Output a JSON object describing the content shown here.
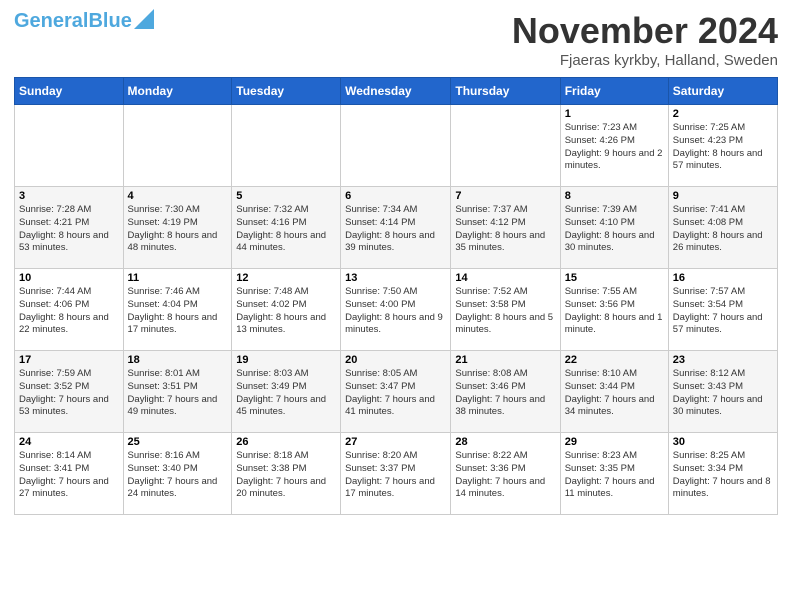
{
  "header": {
    "logo_line1": "General",
    "logo_line2": "Blue",
    "month_title": "November 2024",
    "location": "Fjaeras kyrkby, Halland, Sweden"
  },
  "days_of_week": [
    "Sunday",
    "Monday",
    "Tuesday",
    "Wednesday",
    "Thursday",
    "Friday",
    "Saturday"
  ],
  "weeks": [
    [
      {
        "day": "",
        "info": ""
      },
      {
        "day": "",
        "info": ""
      },
      {
        "day": "",
        "info": ""
      },
      {
        "day": "",
        "info": ""
      },
      {
        "day": "",
        "info": ""
      },
      {
        "day": "1",
        "info": "Sunrise: 7:23 AM\nSunset: 4:26 PM\nDaylight: 9 hours and 2 minutes."
      },
      {
        "day": "2",
        "info": "Sunrise: 7:25 AM\nSunset: 4:23 PM\nDaylight: 8 hours and 57 minutes."
      }
    ],
    [
      {
        "day": "3",
        "info": "Sunrise: 7:28 AM\nSunset: 4:21 PM\nDaylight: 8 hours and 53 minutes."
      },
      {
        "day": "4",
        "info": "Sunrise: 7:30 AM\nSunset: 4:19 PM\nDaylight: 8 hours and 48 minutes."
      },
      {
        "day": "5",
        "info": "Sunrise: 7:32 AM\nSunset: 4:16 PM\nDaylight: 8 hours and 44 minutes."
      },
      {
        "day": "6",
        "info": "Sunrise: 7:34 AM\nSunset: 4:14 PM\nDaylight: 8 hours and 39 minutes."
      },
      {
        "day": "7",
        "info": "Sunrise: 7:37 AM\nSunset: 4:12 PM\nDaylight: 8 hours and 35 minutes."
      },
      {
        "day": "8",
        "info": "Sunrise: 7:39 AM\nSunset: 4:10 PM\nDaylight: 8 hours and 30 minutes."
      },
      {
        "day": "9",
        "info": "Sunrise: 7:41 AM\nSunset: 4:08 PM\nDaylight: 8 hours and 26 minutes."
      }
    ],
    [
      {
        "day": "10",
        "info": "Sunrise: 7:44 AM\nSunset: 4:06 PM\nDaylight: 8 hours and 22 minutes."
      },
      {
        "day": "11",
        "info": "Sunrise: 7:46 AM\nSunset: 4:04 PM\nDaylight: 8 hours and 17 minutes."
      },
      {
        "day": "12",
        "info": "Sunrise: 7:48 AM\nSunset: 4:02 PM\nDaylight: 8 hours and 13 minutes."
      },
      {
        "day": "13",
        "info": "Sunrise: 7:50 AM\nSunset: 4:00 PM\nDaylight: 8 hours and 9 minutes."
      },
      {
        "day": "14",
        "info": "Sunrise: 7:52 AM\nSunset: 3:58 PM\nDaylight: 8 hours and 5 minutes."
      },
      {
        "day": "15",
        "info": "Sunrise: 7:55 AM\nSunset: 3:56 PM\nDaylight: 8 hours and 1 minute."
      },
      {
        "day": "16",
        "info": "Sunrise: 7:57 AM\nSunset: 3:54 PM\nDaylight: 7 hours and 57 minutes."
      }
    ],
    [
      {
        "day": "17",
        "info": "Sunrise: 7:59 AM\nSunset: 3:52 PM\nDaylight: 7 hours and 53 minutes."
      },
      {
        "day": "18",
        "info": "Sunrise: 8:01 AM\nSunset: 3:51 PM\nDaylight: 7 hours and 49 minutes."
      },
      {
        "day": "19",
        "info": "Sunrise: 8:03 AM\nSunset: 3:49 PM\nDaylight: 7 hours and 45 minutes."
      },
      {
        "day": "20",
        "info": "Sunrise: 8:05 AM\nSunset: 3:47 PM\nDaylight: 7 hours and 41 minutes."
      },
      {
        "day": "21",
        "info": "Sunrise: 8:08 AM\nSunset: 3:46 PM\nDaylight: 7 hours and 38 minutes."
      },
      {
        "day": "22",
        "info": "Sunrise: 8:10 AM\nSunset: 3:44 PM\nDaylight: 7 hours and 34 minutes."
      },
      {
        "day": "23",
        "info": "Sunrise: 8:12 AM\nSunset: 3:43 PM\nDaylight: 7 hours and 30 minutes."
      }
    ],
    [
      {
        "day": "24",
        "info": "Sunrise: 8:14 AM\nSunset: 3:41 PM\nDaylight: 7 hours and 27 minutes."
      },
      {
        "day": "25",
        "info": "Sunrise: 8:16 AM\nSunset: 3:40 PM\nDaylight: 7 hours and 24 minutes."
      },
      {
        "day": "26",
        "info": "Sunrise: 8:18 AM\nSunset: 3:38 PM\nDaylight: 7 hours and 20 minutes."
      },
      {
        "day": "27",
        "info": "Sunrise: 8:20 AM\nSunset: 3:37 PM\nDaylight: 7 hours and 17 minutes."
      },
      {
        "day": "28",
        "info": "Sunrise: 8:22 AM\nSunset: 3:36 PM\nDaylight: 7 hours and 14 minutes."
      },
      {
        "day": "29",
        "info": "Sunrise: 8:23 AM\nSunset: 3:35 PM\nDaylight: 7 hours and 11 minutes."
      },
      {
        "day": "30",
        "info": "Sunrise: 8:25 AM\nSunset: 3:34 PM\nDaylight: 7 hours and 8 minutes."
      }
    ]
  ]
}
